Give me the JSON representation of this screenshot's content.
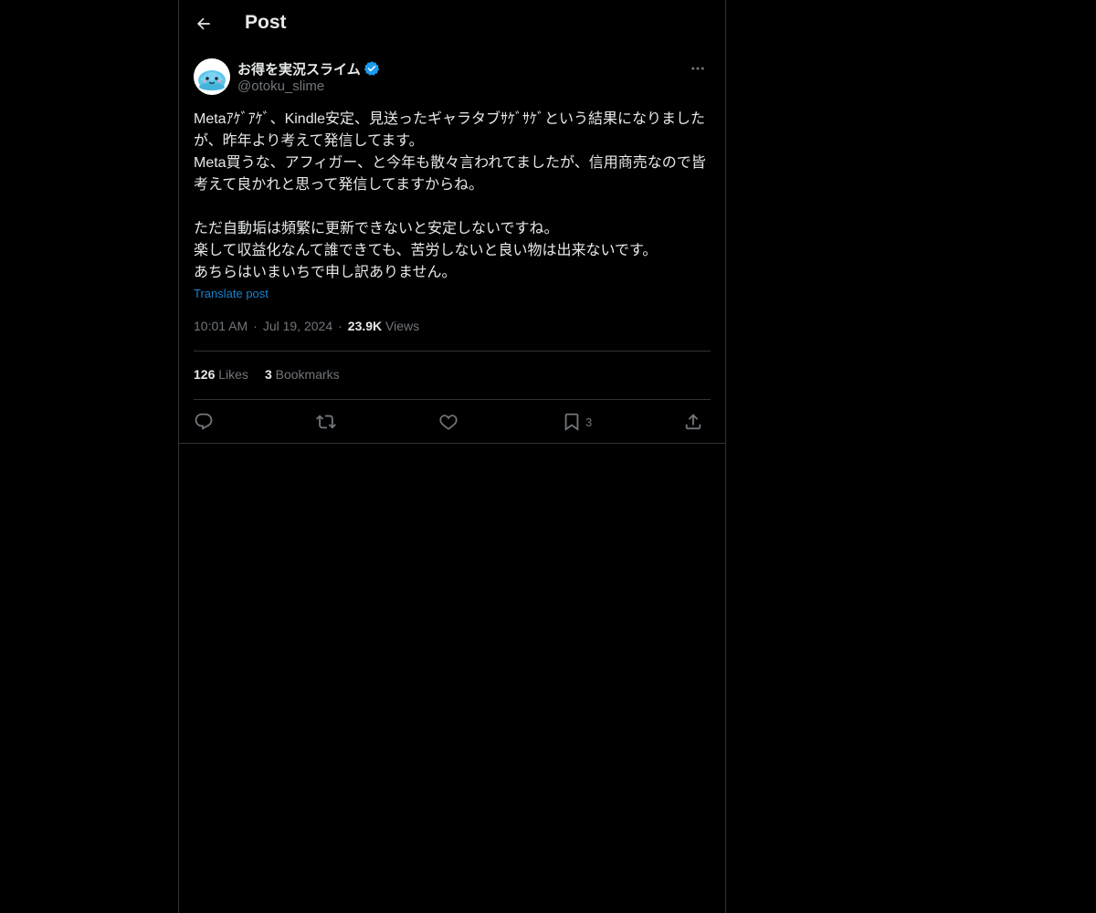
{
  "header": {
    "title": "Post"
  },
  "author": {
    "display_name": "お得を実況スライム",
    "handle": "@otoku_slime",
    "verified": true
  },
  "tweet": {
    "text": "Metaｱｹﾞｱｹﾞ、Kindle安定、見送ったギャラタブｻｹﾞｻｹﾞという結果になりましたが、昨年より考えて発信してます。\nMeta買うな、アフィガー、と今年も散々言われてましたが、信用商売なので皆考えて良かれと思って発信してますからね。\n\nただ自動垢は頻繁に更新できないと安定しないですね。\n楽して収益化なんて誰できても、苦労しないと良い物は出来ないです。\nあちらはいまいちで申し訳ありません。",
    "translate_label": "Translate post",
    "time": "10:01 AM",
    "date": "Jul 19, 2024",
    "views_count": "23.9K",
    "views_label": "Views"
  },
  "stats": {
    "likes_count": "126",
    "likes_label": "Likes",
    "bookmarks_count": "3",
    "bookmarks_label": "Bookmarks"
  },
  "actions": {
    "reply_icon": "reply-icon",
    "repost_icon": "repost-icon",
    "like_icon": "heart-icon",
    "bookmark_icon": "bookmark-icon",
    "bookmark_count": "3",
    "share_icon": "share-icon"
  },
  "colors": {
    "background": "#000000",
    "text": "#e7e9ea",
    "secondary": "#71767b",
    "accent": "#1d9bf0",
    "border": "#2f3336"
  }
}
